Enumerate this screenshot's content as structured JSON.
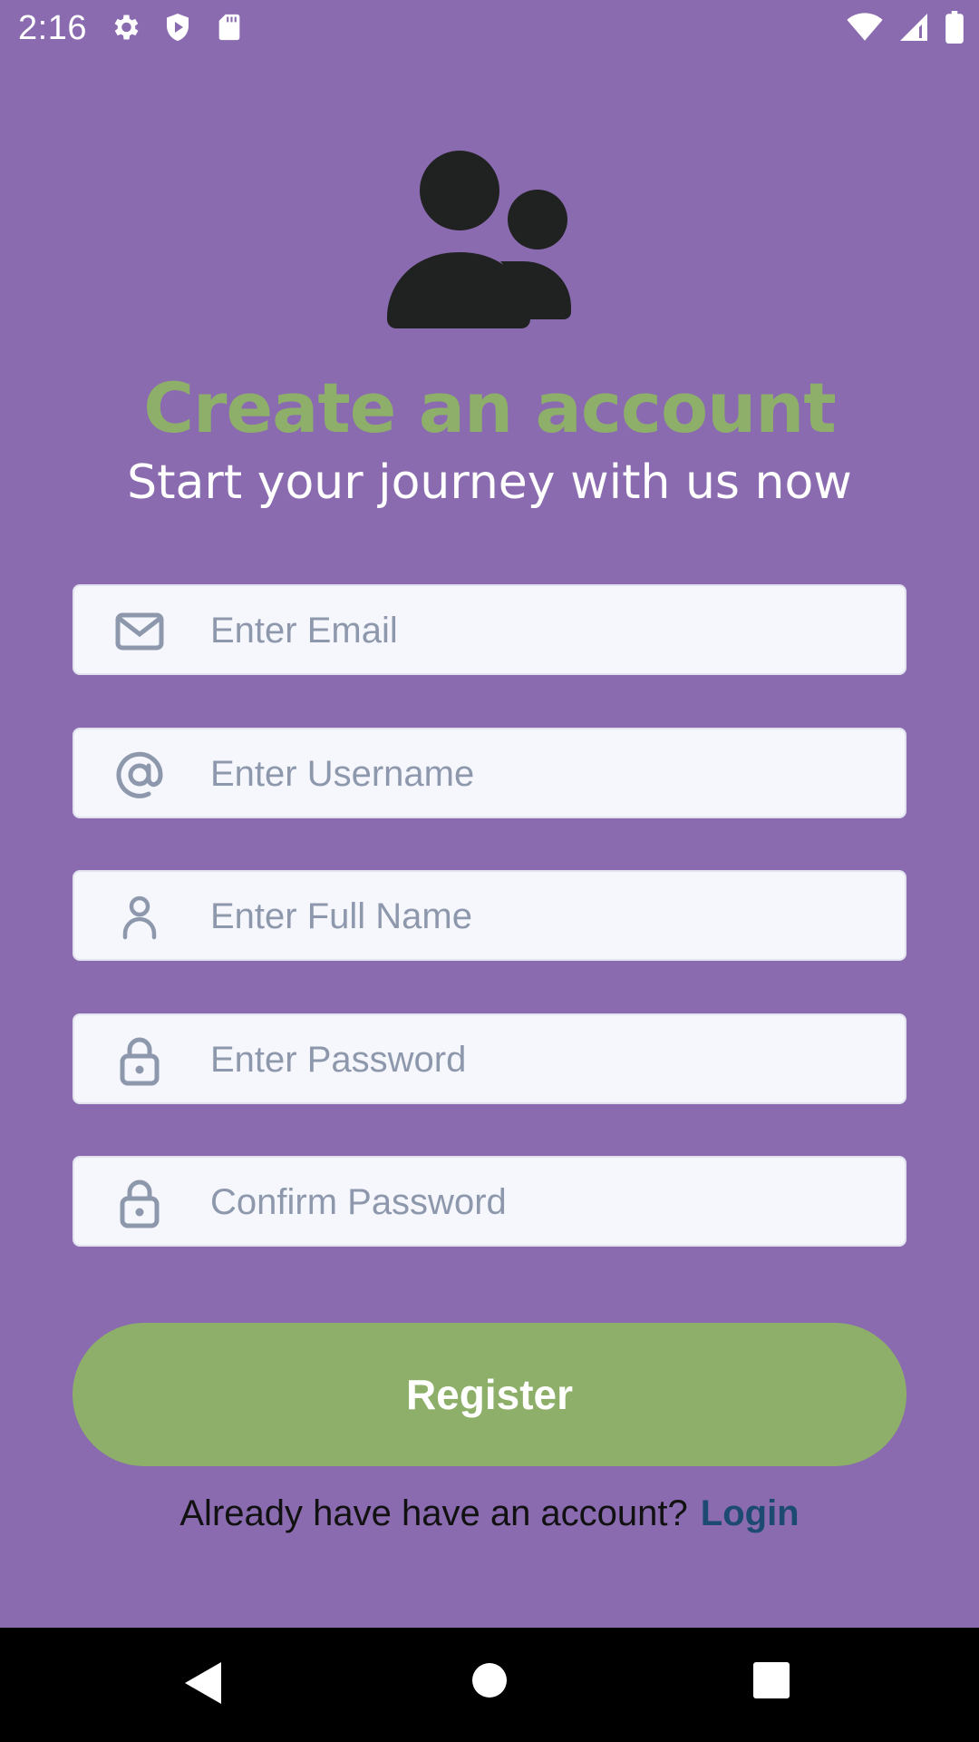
{
  "status_bar": {
    "time": "2:16",
    "icons": [
      "gear-icon",
      "shield-play-icon",
      "sd-card-icon",
      "wifi-icon",
      "cell-signal-icon",
      "battery-icon"
    ]
  },
  "hero": {
    "icon": "users-icon"
  },
  "header": {
    "title": "Create an account",
    "subtitle": "Start your journey with us now"
  },
  "form": {
    "email_placeholder": "Enter Email",
    "username_placeholder": "Enter Username",
    "fullname_placeholder": "Enter Full Name",
    "password_placeholder": "Enter Password",
    "confirm_password_placeholder": "Confirm Password",
    "register_label": "Register"
  },
  "footer": {
    "prompt": "Already have have an account?",
    "login_label": "Login"
  },
  "colors": {
    "background": "#8a6baf",
    "accent_green": "#8eaf69",
    "link": "#1c4a70",
    "field_bg": "#f6f7fc",
    "placeholder": "#8e98ad"
  },
  "nav": {
    "icons": [
      "back-icon",
      "home-icon",
      "recents-icon"
    ]
  }
}
